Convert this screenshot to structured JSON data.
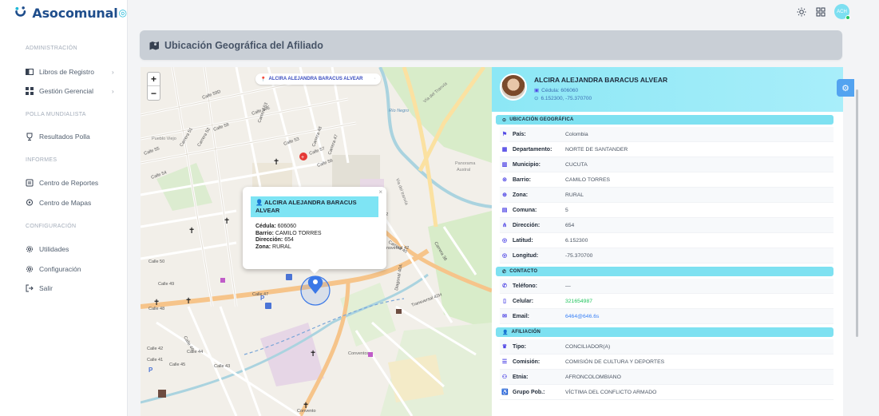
{
  "brand": {
    "name": "Asocomunal",
    "mark": "◎"
  },
  "sidebar": {
    "sections": [
      {
        "title": "ADMINISTRACIÓN",
        "items": [
          {
            "label": "Libros de Registro",
            "icon": "book-icon",
            "has_submenu": true
          },
          {
            "label": "Gestión Gerencial",
            "icon": "grid-icon",
            "has_submenu": true
          }
        ]
      },
      {
        "title": "POLLA MUNDIALISTA",
        "items": [
          {
            "label": "Resultados Polla",
            "icon": "trophy-icon"
          }
        ]
      },
      {
        "title": "INFORMES",
        "items": [
          {
            "label": "Centro de Reportes",
            "icon": "report-icon"
          },
          {
            "label": "Centro de Mapas",
            "icon": "map-pin-icon"
          }
        ]
      },
      {
        "title": "CONFIGURACIÓN",
        "items": [
          {
            "label": "Utilidades",
            "icon": "gear-icon"
          },
          {
            "label": "Configuración",
            "icon": "gear-icon"
          },
          {
            "label": "Salir",
            "icon": "logout-icon"
          }
        ]
      }
    ]
  },
  "topbar": {
    "avatar_initials": "ACH"
  },
  "page": {
    "title": "Ubicación Geográfica del Afiliado"
  },
  "map": {
    "chip_label": "ALCIRA ALEJANDRA BARACUS ALVEAR",
    "popup": {
      "name": "ALCIRA ALEJANDRA BARACUS ALVEAR",
      "cedula_label": "Cédula:",
      "cedula": "606060",
      "barrio_label": "Barrio:",
      "barrio": "CAMILO TORRES",
      "direccion_label": "Dirección:",
      "direccion": "654",
      "zona_label": "Zona:",
      "zona": "RURAL"
    },
    "street_labels": [
      "Calle 59D",
      "Calle 59E",
      "Calle 58",
      "Calle 57",
      "Calle 56",
      "Calle 55",
      "Calle 54",
      "Calle 53",
      "Calle 52",
      "Calle 50",
      "Calle 49",
      "Calle 48",
      "Calle 47",
      "Calle 46",
      "Calle 45",
      "Calle 44",
      "Calle 43",
      "Calle 42",
      "Calle 41",
      "Carrera 51",
      "Carrera 52",
      "Carrera 53",
      "Carrera 48",
      "Carrera 47",
      "Carrera 40",
      "Carrera 36",
      "Diagonal 40A",
      "Transversal 42H",
      "Transversal 42",
      "Vía del Tranvía",
      "Via del tranvía",
      "Río Negro",
      "Panorama Austral",
      "Convento",
      "Pueblo Viejo",
      "Conventos"
    ]
  },
  "profile": {
    "name": "ALCIRA ALEJANDRA BARACUS ALVEAR",
    "cedula_text": "Cédula: 606060",
    "coords_text": "6.152300, -75.370700",
    "sections": [
      {
        "title": "UBICACIÓN GEOGRÁFICA",
        "icon": "map-pin-icon",
        "rows": [
          {
            "label": "País:",
            "value": "Colombia",
            "icon": "flag-icon"
          },
          {
            "label": "Departamento:",
            "value": "NORTE DE SANTANDER",
            "icon": "map-icon"
          },
          {
            "label": "Municipio:",
            "value": "CUCUTA",
            "icon": "city-icon"
          },
          {
            "label": "Barrio:",
            "value": "CAMILO TORRES",
            "icon": "pin-icon"
          },
          {
            "label": "Zona:",
            "value": "RURAL",
            "icon": "globe-icon"
          },
          {
            "label": "Comuna:",
            "value": "5",
            "icon": "building-icon"
          },
          {
            "label": "Dirección:",
            "value": "654",
            "icon": "road-icon"
          },
          {
            "label": "Latitud:",
            "value": "6.152300",
            "icon": "compass-icon"
          },
          {
            "label": "Longitud:",
            "value": "-75.370700",
            "icon": "compass-icon"
          }
        ]
      },
      {
        "title": "CONTACTO",
        "icon": "phone-icon",
        "rows": [
          {
            "label": "Teléfono:",
            "value": "—",
            "icon": "phone-icon"
          },
          {
            "label": "Celular:",
            "value": "321654987",
            "icon": "mobile-icon",
            "style": "green"
          },
          {
            "label": "Email:",
            "value": "6464@646.6s",
            "icon": "mail-icon",
            "style": "link"
          }
        ]
      },
      {
        "title": "AFILIACIÓN",
        "icon": "user-icon",
        "rows": [
          {
            "label": "Tipo:",
            "value": "CONCILIADOR(A)",
            "icon": "crown-icon"
          },
          {
            "label": "Comisión:",
            "value": "COMISIÓN DE CULTURA Y DEPORTES",
            "icon": "list-icon"
          },
          {
            "label": "Etnia:",
            "value": "AFRONCOLOMBIANO",
            "icon": "users-icon"
          },
          {
            "label": "Grupo Pob.:",
            "value": "VÍCTIMA DEL CONFLICTO ARMADO",
            "icon": "accessibility-icon"
          }
        ]
      }
    ]
  },
  "colors": {
    "accent": "#7ee1f1",
    "brand": "#1f4e8c",
    "link": "#3b82f6",
    "ok": "#22c55e"
  }
}
